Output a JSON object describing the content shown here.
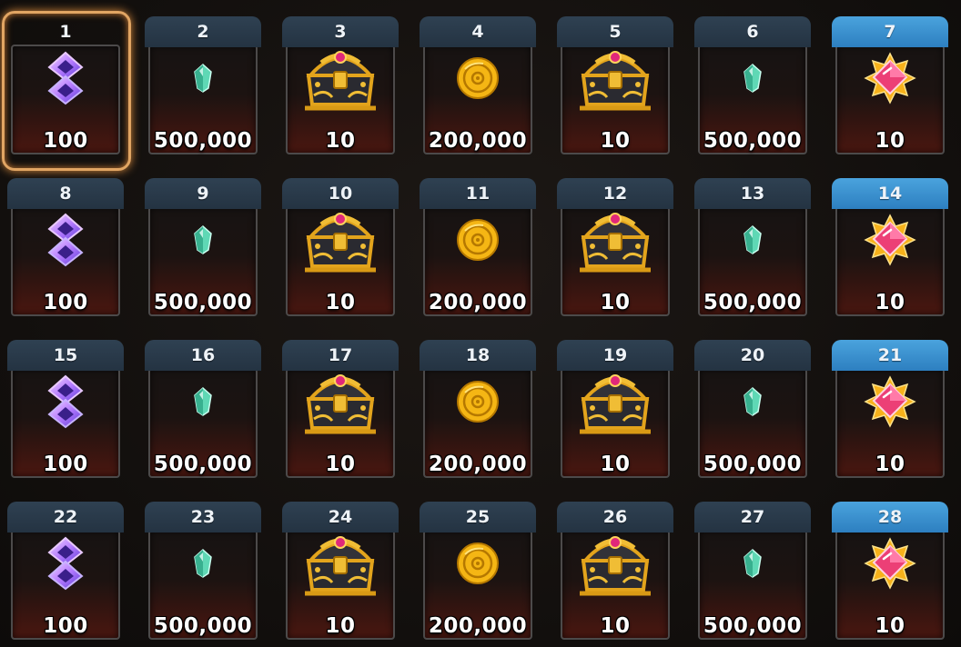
{
  "rewards": [
    {
      "day": "1",
      "qty": "100",
      "icon": "purple-rune-icon",
      "selected": true
    },
    {
      "day": "2",
      "qty": "500,000",
      "icon": "green-crystal-icon"
    },
    {
      "day": "3",
      "qty": "10",
      "icon": "treasure-chest-icon"
    },
    {
      "day": "4",
      "qty": "200,000",
      "icon": "gold-coin-icon"
    },
    {
      "day": "5",
      "qty": "10",
      "icon": "treasure-chest-icon"
    },
    {
      "day": "6",
      "qty": "500,000",
      "icon": "green-crystal-icon"
    },
    {
      "day": "7",
      "qty": "10",
      "icon": "pink-gem-star-icon",
      "special": true
    },
    {
      "day": "8",
      "qty": "100",
      "icon": "purple-rune-icon"
    },
    {
      "day": "9",
      "qty": "500,000",
      "icon": "green-crystal-icon"
    },
    {
      "day": "10",
      "qty": "10",
      "icon": "treasure-chest-icon"
    },
    {
      "day": "11",
      "qty": "200,000",
      "icon": "gold-coin-icon"
    },
    {
      "day": "12",
      "qty": "10",
      "icon": "treasure-chest-icon"
    },
    {
      "day": "13",
      "qty": "500,000",
      "icon": "green-crystal-icon"
    },
    {
      "day": "14",
      "qty": "10",
      "icon": "pink-gem-star-icon",
      "special": true
    },
    {
      "day": "15",
      "qty": "100",
      "icon": "purple-rune-icon"
    },
    {
      "day": "16",
      "qty": "500,000",
      "icon": "green-crystal-icon"
    },
    {
      "day": "17",
      "qty": "10",
      "icon": "treasure-chest-icon"
    },
    {
      "day": "18",
      "qty": "200,000",
      "icon": "gold-coin-icon"
    },
    {
      "day": "19",
      "qty": "10",
      "icon": "treasure-chest-icon"
    },
    {
      "day": "20",
      "qty": "500,000",
      "icon": "green-crystal-icon"
    },
    {
      "day": "21",
      "qty": "10",
      "icon": "pink-gem-star-icon",
      "special": true
    },
    {
      "day": "22",
      "qty": "100",
      "icon": "purple-rune-icon"
    },
    {
      "day": "23",
      "qty": "500,000",
      "icon": "green-crystal-icon"
    },
    {
      "day": "24",
      "qty": "10",
      "icon": "treasure-chest-icon"
    },
    {
      "day": "25",
      "qty": "200,000",
      "icon": "gold-coin-icon"
    },
    {
      "day": "26",
      "qty": "10",
      "icon": "treasure-chest-icon"
    },
    {
      "day": "27",
      "qty": "500,000",
      "icon": "green-crystal-icon"
    },
    {
      "day": "28",
      "qty": "10",
      "icon": "pink-gem-star-icon",
      "special": true
    }
  ],
  "colors": {
    "header": "#2f4152",
    "header_special": "#3b93d2",
    "selection_glow": "#e1a563"
  }
}
